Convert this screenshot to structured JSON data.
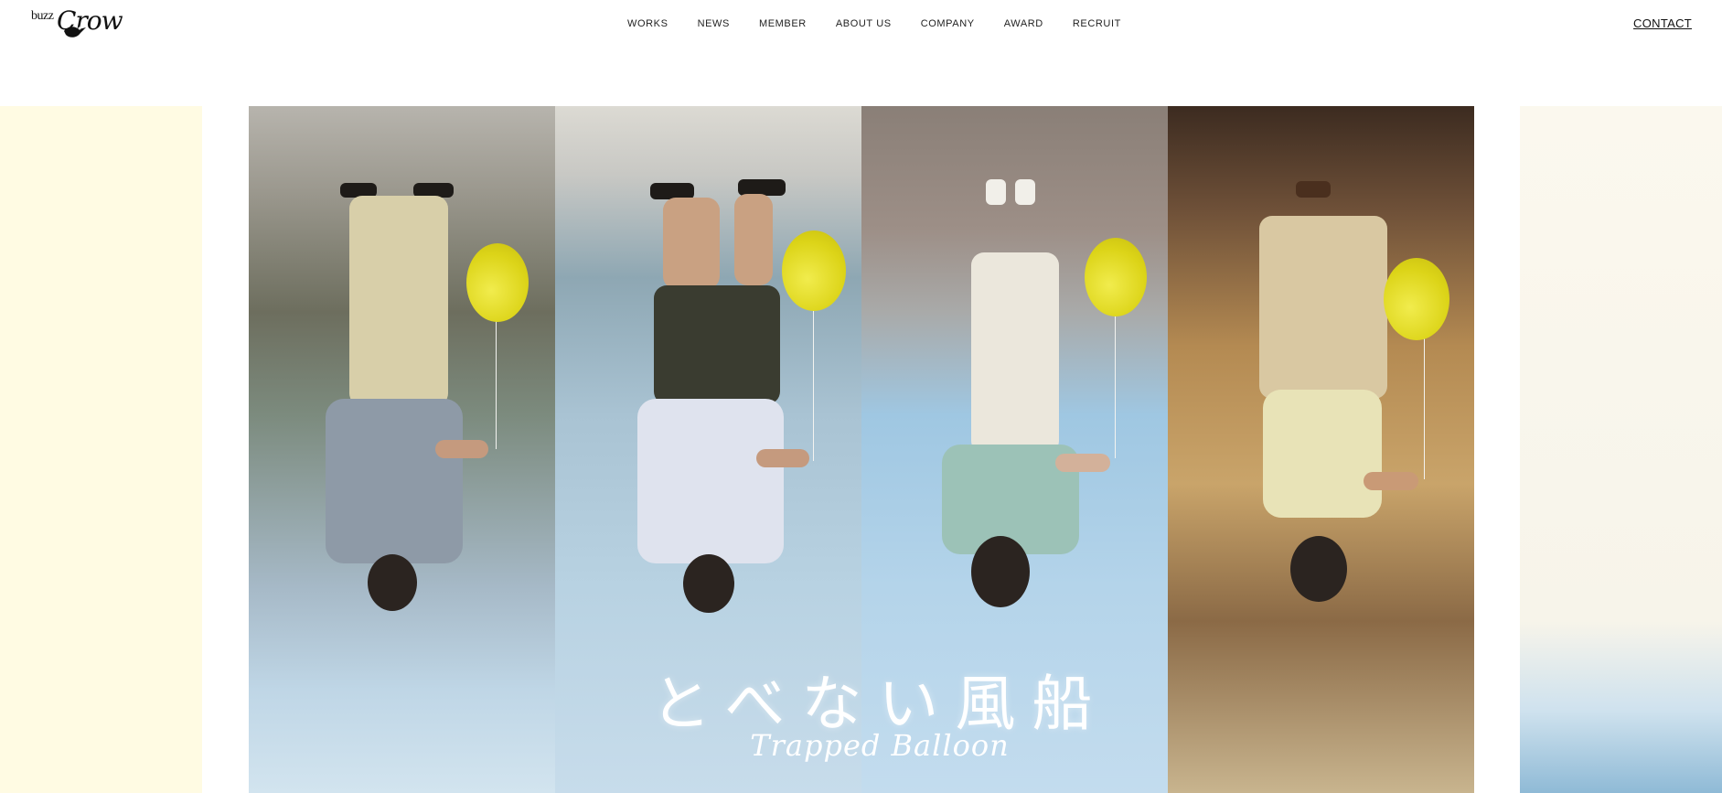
{
  "brand": {
    "logo_small": "buzz",
    "logo_big": "Crow"
  },
  "nav": {
    "items": [
      {
        "label": "WORKS"
      },
      {
        "label": "NEWS"
      },
      {
        "label": "MEMBER"
      },
      {
        "label": "ABOUT US"
      },
      {
        "label": "COMPANY"
      },
      {
        "label": "AWARD"
      },
      {
        "label": "RECRUIT"
      }
    ]
  },
  "header": {
    "contact_label": "CONTACT"
  },
  "hero": {
    "title_jp": "とべない風船",
    "title_en": "Trapped Balloon",
    "balloon_color": "#e3dc1f"
  }
}
